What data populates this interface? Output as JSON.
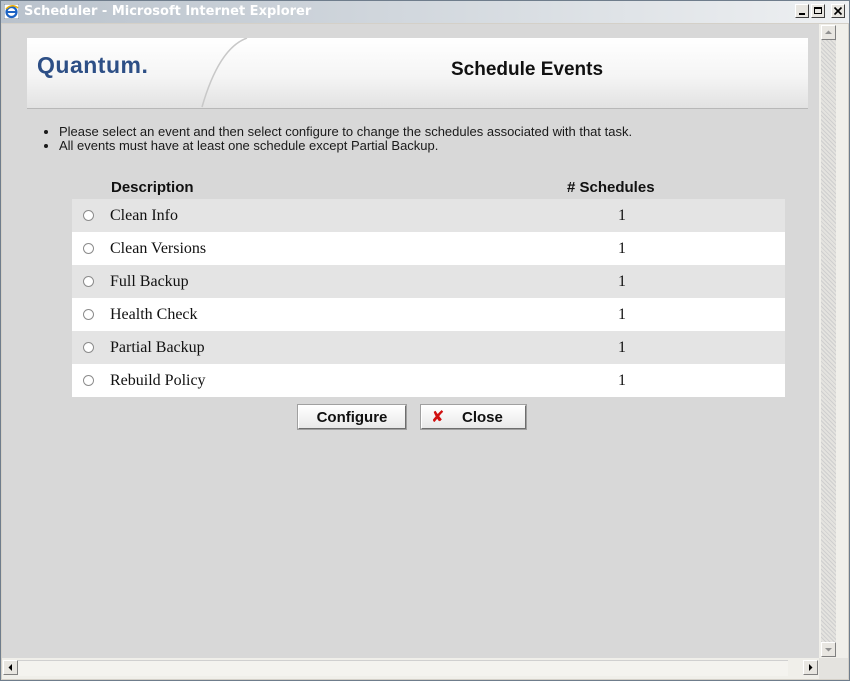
{
  "window": {
    "title": "Scheduler - Microsoft Internet Explorer"
  },
  "banner": {
    "logo": "Quantum.",
    "heading": "Schedule Events"
  },
  "instructions": [
    "Please select an event and then select configure to change the schedules associated with that task.",
    "All events must have at least one schedule except Partial Backup."
  ],
  "table": {
    "headers": {
      "description": "Description",
      "schedules": "# Schedules"
    },
    "rows": [
      {
        "description": "Clean Info",
        "schedules": "1"
      },
      {
        "description": "Clean Versions",
        "schedules": "1"
      },
      {
        "description": "Full Backup",
        "schedules": "1"
      },
      {
        "description": "Health Check",
        "schedules": "1"
      },
      {
        "description": "Partial Backup",
        "schedules": "1"
      },
      {
        "description": "Rebuild Policy",
        "schedules": "1"
      }
    ]
  },
  "buttons": {
    "configure": "Configure",
    "close": "Close"
  },
  "icons": {
    "window": "internet-explorer-icon",
    "close_button": "red-x-icon",
    "minimize": "minimize-icon",
    "maximize": "maximize-icon",
    "window_close": "close-icon"
  },
  "colors": {
    "logo": "#2d4f86",
    "close_x": "#d01010",
    "row_shade": "#e4e4e4"
  }
}
